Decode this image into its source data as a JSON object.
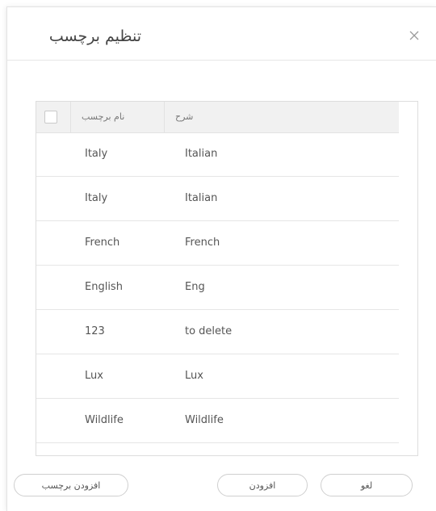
{
  "dialog": {
    "title": "تنظیم برچسب",
    "close_icon": "close-icon"
  },
  "table": {
    "headers": {
      "name": "نام برچسب",
      "description": "شرح"
    },
    "rows": [
      {
        "name": "Italy",
        "description": "Italian"
      },
      {
        "name": "Italy",
        "description": "Italian"
      },
      {
        "name": "French",
        "description": "French"
      },
      {
        "name": "English",
        "description": "Eng"
      },
      {
        "name": "123",
        "description": "to delete"
      },
      {
        "name": "Lux",
        "description": "Lux"
      },
      {
        "name": "Wildlife",
        "description": "Wildlife"
      }
    ]
  },
  "footer": {
    "add_tag_label": "افزودن برچسب",
    "add_label": "افزودن",
    "cancel_label": "لغو"
  }
}
